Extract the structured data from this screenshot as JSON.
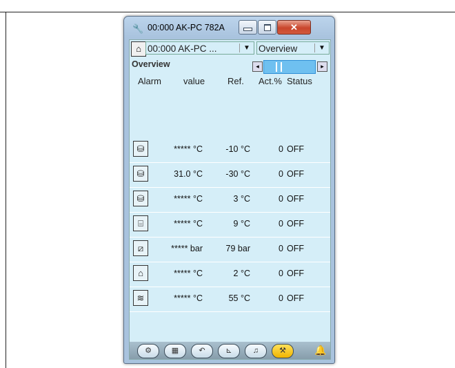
{
  "window": {
    "title": "00:000 AK-PC 782A",
    "close_glyph": "✕"
  },
  "toolbar": {
    "device_select": "00:000 AK-PC ...",
    "view_select": "Overview"
  },
  "section_label": "Overview",
  "columns": {
    "alarm": "Alarm",
    "value": "value",
    "ref": "Ref.",
    "act": "Act.%",
    "status": "Status"
  },
  "rows": [
    {
      "icon": "compressor-icon",
      "value": "***** °C",
      "ref": "-10 °C",
      "act": "0",
      "status": "OFF"
    },
    {
      "icon": "compressor-icon",
      "value": "31.0 °C",
      "ref": "-30 °C",
      "act": "0",
      "status": "OFF"
    },
    {
      "icon": "compressor-icon",
      "value": "***** °C",
      "ref": "3 °C",
      "act": "0",
      "status": "OFF"
    },
    {
      "icon": "evaporator-icon",
      "value": "***** °C",
      "ref": "9 °C",
      "act": "0",
      "status": "OFF"
    },
    {
      "icon": "condenser-icon",
      "value": "***** bar",
      "ref": "79 bar",
      "act": "0",
      "status": "OFF"
    },
    {
      "icon": "receiver-icon",
      "value": "***** °C",
      "ref": "2 °C",
      "act": "0",
      "status": "OFF"
    },
    {
      "icon": "heat-exchanger-icon",
      "value": "***** °C",
      "ref": "55 °C",
      "act": "0",
      "status": "OFF"
    }
  ],
  "bottom_nav": [
    {
      "icon": "plant-overview-icon",
      "active": false
    },
    {
      "icon": "grid-icon",
      "active": false
    },
    {
      "icon": "undo-icon",
      "active": false
    },
    {
      "icon": "trend-graph-icon",
      "active": false
    },
    {
      "icon": "alarm-bell-outline-icon",
      "active": false
    },
    {
      "icon": "wrench-icon",
      "active": true
    }
  ],
  "colors": {
    "client_background": "#d5eef8",
    "active_nav": "#f0b400",
    "alarm_bell": "#e00000",
    "segment_highlight": "#6fc0f0"
  }
}
